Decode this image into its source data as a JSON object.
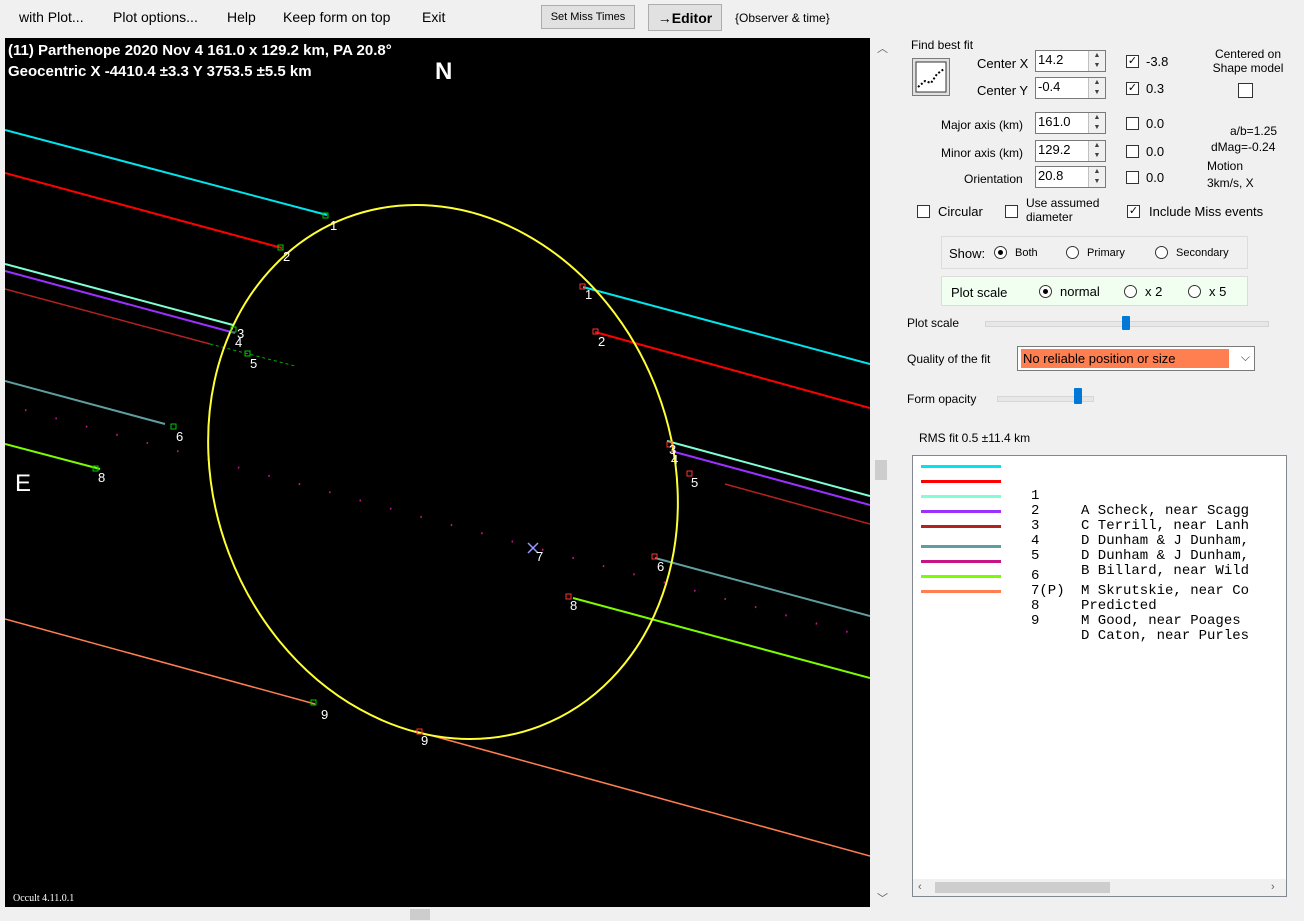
{
  "menu": {
    "with_plot": "with Plot...",
    "plot_options": "Plot options...",
    "help": "Help",
    "keep_form": "Keep form on top",
    "exit": "Exit",
    "set_miss_times": "Set Miss Times",
    "editor": "→Editor",
    "observer_time": "{Observer & time}"
  },
  "plot": {
    "title_line1": "(11) Parthenope  2020 Nov 4   161.0 x 129.2 km, PA 20.8°",
    "title_line2": "Geocentric  X  -4410.4 ±3.3  Y 3753.5 ±5.5 km",
    "north_label": "N",
    "east_label": "E",
    "version": "Occult 4.11.0.1",
    "chord_labels": [
      "1",
      "2",
      "3",
      "4",
      "5",
      "6",
      "7",
      "8",
      "9"
    ]
  },
  "fit": {
    "group_title": "Find best fit",
    "center_x_label": "Center X",
    "center_x_value": "14.2",
    "center_x_err": "-3.8",
    "center_y_label": "Center Y",
    "center_y_value": "-0.4",
    "center_y_err": "0.3",
    "major_label": "Major axis (km)",
    "major_value": "161.0",
    "major_err": "0.0",
    "minor_label": "Minor axis (km)",
    "minor_value": "129.2",
    "minor_err": "0.0",
    "orient_label": "Orientation",
    "orient_value": "20.8",
    "orient_err": "0.0",
    "centered_label": "Centered on Shape model",
    "ab_ratio": "a/b=1.25",
    "dmag": "dMag=-0.24",
    "motion_label": "Motion",
    "motion_value": "3km/s, X",
    "circular_label": "Circular",
    "assumed_label": "Use assumed diameter",
    "include_miss_label": "Include Miss events"
  },
  "show": {
    "label": "Show:",
    "options": [
      "Both",
      "Primary",
      "Secondary"
    ],
    "selected": "Both"
  },
  "plot_scale": {
    "label": "Plot scale",
    "options": [
      "normal",
      "x 2",
      "x 5"
    ],
    "selected": "normal",
    "slider_label": "Plot scale"
  },
  "quality": {
    "label": "Quality of the fit",
    "value": "No reliable position or size",
    "color": "#ff7f50"
  },
  "opacity": {
    "label": "Form opacity"
  },
  "rms": "RMS fit 0.5 ±11.4 km",
  "observers": [
    {
      "num": "1",
      "name": "A Scheck, near Scagg",
      "color": "#00e5ee"
    },
    {
      "num": "2",
      "name": "C Terrill, near Lanh",
      "color": "#ff0000"
    },
    {
      "num": "3",
      "name": "D Dunham & J Dunham,",
      "color": "#7fffd4"
    },
    {
      "num": "4",
      "name": "D Dunham & J Dunham,",
      "color": "#9b30ff"
    },
    {
      "num": "5",
      "name": "B Billard, near Wild",
      "color": "#b22222"
    },
    {
      "num": "6",
      "name": "M Skrutskie, near Co",
      "color": "#5f9ea0"
    },
    {
      "num": "7(P)",
      "name": "Predicted",
      "color": "#c71585"
    },
    {
      "num": "8",
      "name": "M Good, near Poages",
      "color": "#7cfc00"
    },
    {
      "num": "9",
      "name": "D Caton, near Purles",
      "color": "#ff7f50"
    }
  ]
}
